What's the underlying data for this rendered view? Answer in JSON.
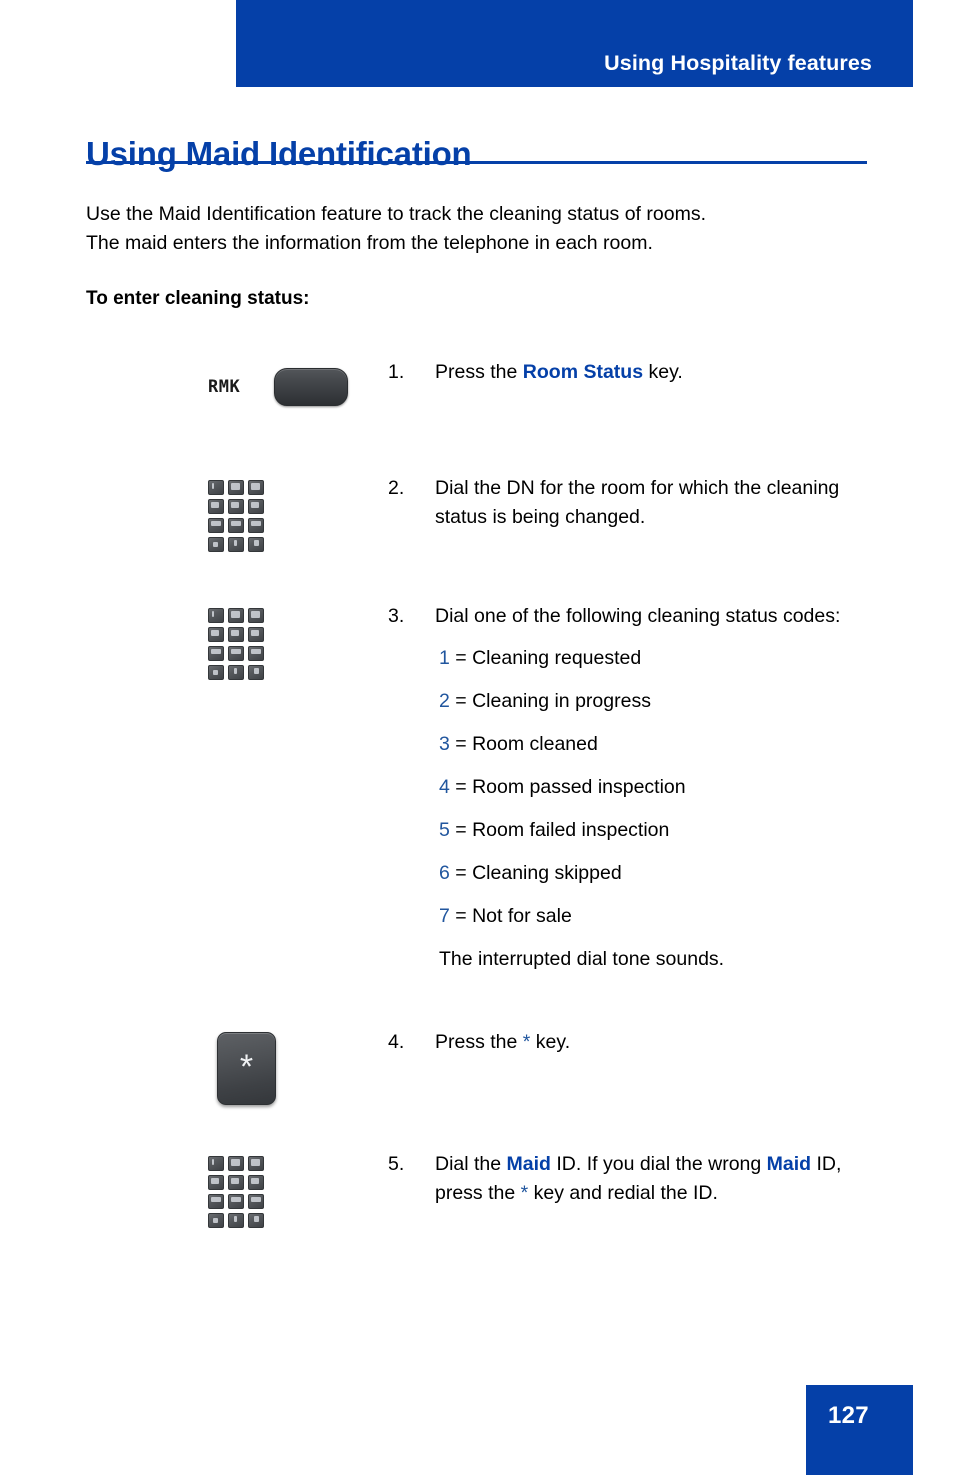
{
  "colors": {
    "brand_blue": "#0540a8",
    "code_blue": "#21569e",
    "text_black": "#000000",
    "key_dark": "#45484c"
  },
  "header": {
    "title": "Using Hospitality features"
  },
  "page": {
    "title": "Using Maid Identification",
    "intro_line1": "Use the Maid Identification feature to track the cleaning status of rooms.",
    "intro_line2": "The maid enters the information from the telephone in each room.",
    "subhead": "To enter cleaning status:"
  },
  "steps": [
    {
      "number": "1.",
      "visual": "room-status-feature-key",
      "key_label": "RMK",
      "text_before": "Press the ",
      "emphasis": "Room Status",
      "text_after": " key."
    },
    {
      "number": "2.",
      "visual": "dialpad",
      "text": "Dial the DN for the room for which the cleaning status is being changed."
    },
    {
      "number": "3.",
      "visual": "dialpad",
      "text": "Dial one of the following cleaning status codes:",
      "codes": [
        {
          "code": "1",
          "equals": "= Cleaning requested"
        },
        {
          "code": "2",
          "equals": "= Cleaning in progress"
        },
        {
          "code": "3",
          "equals": "= Room cleaned"
        },
        {
          "code": "4",
          "equals": "= Room passed inspection"
        },
        {
          "code": "5",
          "equals": "= Room failed inspection"
        },
        {
          "code": "6",
          "equals": "= Cleaning skipped"
        },
        {
          "code": "7",
          "equals": "= Not for sale"
        }
      ],
      "note": "The interrupted dial tone sounds."
    },
    {
      "number": "4.",
      "visual": "star-key",
      "key_glyph": "*",
      "text_before": "Press the ",
      "emphasis": "*",
      "text_after": " key."
    },
    {
      "number": "5.",
      "visual": "dialpad",
      "seg1": "Dial the ",
      "em1": "Maid",
      "seg2": " ID. If you dial the wrong ",
      "em2": "Maid",
      "seg3": " ID, press the ",
      "em3": "*",
      "seg4": " key and redial the ID."
    }
  ],
  "keypad": {
    "keys": [
      "1",
      "2",
      "3",
      "4",
      "5",
      "6",
      "7",
      "8",
      "9",
      "*",
      "0",
      "#"
    ]
  },
  "footer": {
    "page_number": "127"
  }
}
